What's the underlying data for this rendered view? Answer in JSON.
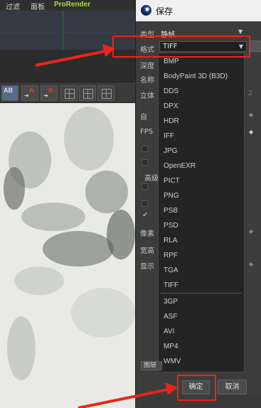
{
  "app": {
    "menu": [
      "过滤",
      "面板",
      "ProRender"
    ],
    "toolbar_labels": {
      "ab": "AB",
      "a": "A",
      "b": "B"
    }
  },
  "dialog": {
    "title": "保存",
    "type_label": "类型",
    "type_value": "静帧",
    "format_label": "格式",
    "format_value": "TIFF",
    "side_labels": [
      "深度",
      "名称",
      "立体",
      "自",
      "FPS",
      "高级",
      "像素",
      "宽高",
      "显示"
    ],
    "side_values": {
      "stereo_num": "2"
    },
    "format_options": [
      "BMP",
      "BodyPaint 3D (B3D)",
      "DDS",
      "DPX",
      "HDR",
      "IFF",
      "JPG",
      "OpenEXR",
      "PICT",
      "PNG",
      "PSB",
      "PSD",
      "RLA",
      "RPF",
      "TGA",
      "TIFF",
      "3GP",
      "ASF",
      "AVI",
      "MP4",
      "WMV"
    ],
    "ok_label": "确定",
    "cancel_label": "取消",
    "bottom_left_label": "图层"
  },
  "colors": {
    "highlight": "#e8261b",
    "accent": "#a8e03c"
  }
}
